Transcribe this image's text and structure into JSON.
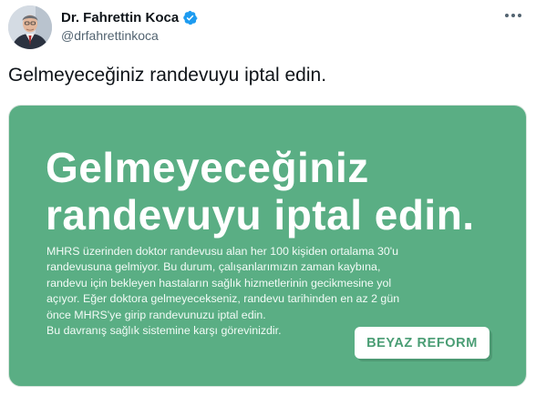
{
  "tweet": {
    "author": {
      "display_name": "Dr. Fahrettin Koca",
      "handle": "@drfahrettinkoca",
      "verified_icon": "verified-badge-icon",
      "avatar": "avatar"
    },
    "more_icon": "more-options-icon",
    "text": "Gelmeyeceğiniz randevuyu iptal edin.",
    "media_card": {
      "headline_lines": [
        "Gelmeyeceğiniz",
        "randevuyu iptal edin."
      ],
      "body_lines": [
        "MHRS üzerinden doktor randevusu alan her 100 kişiden ortalama 30'u",
        "randevusuna gelmiyor. Bu durum, çalışanlarımızın zaman kaybına,",
        "randevu için bekleyen hastaların sağlık hizmetlerinin gecikmesine yol",
        "açıyor. Eğer doktora gelmeyecekseniz, randevu tarihinden en az 2 gün",
        "önce MHRS'ye girip randevunuzu iptal edin.",
        "Bu davranış sağlık sistemine karşı görevinizdir."
      ],
      "badge": "BEYAZ REFORM"
    }
  },
  "colors": {
    "card_background": "#5aae84",
    "verified_blue": "#1d9bf0",
    "badge_text": "#4a9d74"
  }
}
